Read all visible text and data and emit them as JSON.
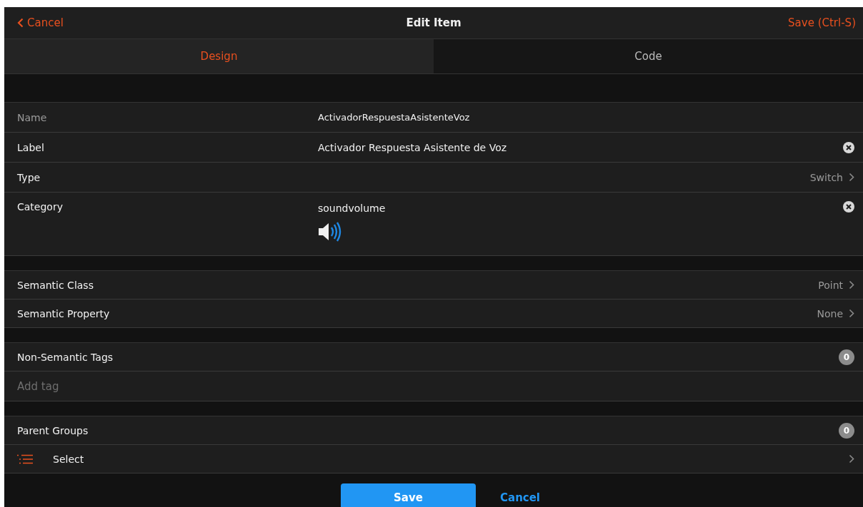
{
  "header": {
    "back": "Cancel",
    "title": "Edit Item",
    "save": "Save (Ctrl-S)"
  },
  "tabs": [
    {
      "label": "Design",
      "selected": true
    },
    {
      "label": "Code",
      "selected": false
    }
  ],
  "sections": [
    {
      "rows": [
        {
          "kind": "field",
          "label": "Name",
          "value": "ActivadorRespuestaAsistenteVoz",
          "disabled": true,
          "clearable": false
        },
        {
          "kind": "field",
          "label": "Label",
          "value": "Activador Respuesta Asistente de Voz",
          "disabled": false,
          "clearable": true
        },
        {
          "kind": "nav",
          "label": "Type",
          "value": "Switch"
        },
        {
          "kind": "category",
          "label": "Category",
          "value": "soundvolume",
          "clearable": true
        }
      ]
    },
    {
      "rows": [
        {
          "kind": "nav",
          "label": "Semantic Class",
          "value": "Point"
        },
        {
          "kind": "nav",
          "label": "Semantic Property",
          "value": "None"
        }
      ]
    },
    {
      "rows": [
        {
          "kind": "counter",
          "label": "Non-Semantic Tags",
          "count": "0"
        },
        {
          "kind": "input",
          "placeholder": "Add tag"
        }
      ]
    },
    {
      "rows": [
        {
          "kind": "counter",
          "label": "Parent Groups",
          "count": "0"
        },
        {
          "kind": "select",
          "label": "Select"
        }
      ]
    }
  ],
  "footer": {
    "save": "Save",
    "cancel": "Cancel"
  }
}
